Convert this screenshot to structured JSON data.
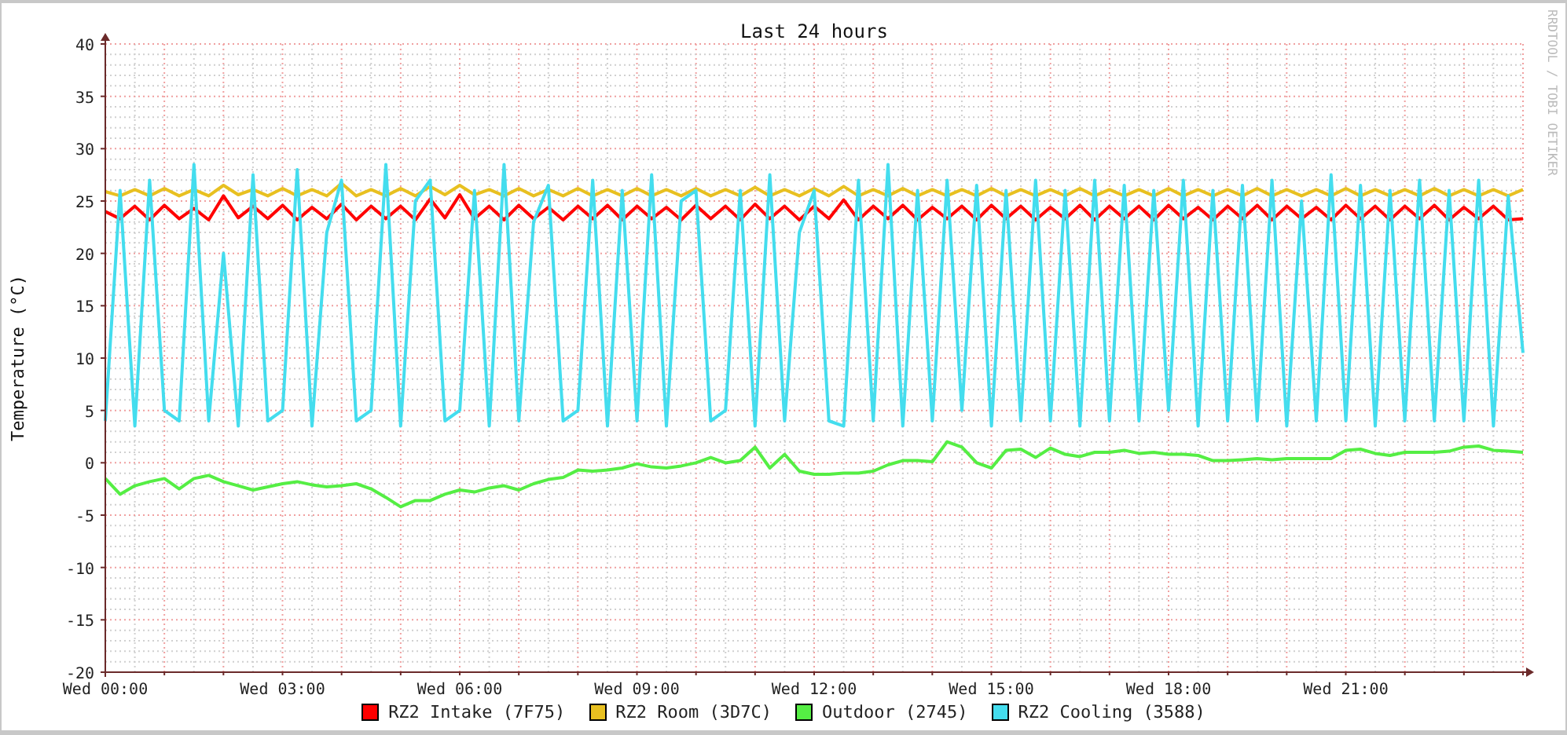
{
  "graph": {
    "credit": "RRDTOOL / TOBI OETIKER",
    "chart_data": {
      "type": "line",
      "grid": true,
      "title": "Last 24 hours",
      "ylabel": "Temperature (°C)",
      "ylim": [
        -20,
        40
      ],
      "yticks": [
        -20,
        -15,
        -10,
        -5,
        0,
        5,
        10,
        15,
        20,
        25,
        30,
        35,
        40
      ],
      "categories": [
        "Wed 00:00",
        null,
        null,
        null,
        null,
        null,
        null,
        null,
        null,
        null,
        null,
        null,
        "Wed 03:00",
        null,
        null,
        null,
        null,
        null,
        null,
        null,
        null,
        null,
        null,
        null,
        "Wed 06:00",
        null,
        null,
        null,
        null,
        null,
        null,
        null,
        null,
        null,
        null,
        null,
        "Wed 09:00",
        null,
        null,
        null,
        null,
        null,
        null,
        null,
        null,
        null,
        null,
        null,
        "Wed 12:00",
        null,
        null,
        null,
        null,
        null,
        null,
        null,
        null,
        null,
        null,
        null,
        "Wed 15:00",
        null,
        null,
        null,
        null,
        null,
        null,
        null,
        null,
        null,
        null,
        null,
        "Wed 18:00",
        null,
        null,
        null,
        null,
        null,
        null,
        null,
        null,
        null,
        null,
        null,
        "Wed 21:00",
        null,
        null,
        null,
        null,
        null,
        null,
        null,
        null,
        null,
        null,
        null,
        null
      ],
      "series": [
        {
          "name": "RZ2 Intake (7F75)",
          "color": "#ff0000",
          "values": [
            24,
            23.3,
            24.5,
            23.2,
            24.6,
            23.3,
            24.3,
            23.2,
            25.5,
            23.4,
            24.5,
            23.3,
            24.6,
            23.2,
            24.4,
            23.3,
            24.7,
            23.2,
            24.5,
            23.3,
            24.5,
            23.2,
            25.2,
            23.4,
            25.6,
            23.3,
            24.5,
            23.2,
            24.6,
            23.3,
            24.4,
            23.2,
            24.5,
            23.3,
            24.6,
            23.2,
            24.5,
            23.3,
            24.4,
            23.2,
            24.6,
            23.3,
            24.5,
            23.2,
            24.7,
            23.3,
            24.5,
            23.2,
            24.5,
            23.3,
            25.1,
            23.2,
            24.5,
            23.3,
            24.6,
            23.2,
            24.4,
            23.3,
            24.5,
            23.2,
            24.6,
            23.3,
            24.5,
            23.2,
            24.4,
            23.3,
            24.6,
            23.2,
            24.5,
            23.3,
            24.5,
            23.2,
            24.6,
            23.3,
            24.4,
            23.2,
            24.5,
            23.3,
            24.6,
            23.2,
            24.5,
            23.3,
            24.4,
            23.2,
            24.6,
            23.3,
            24.5,
            23.2,
            24.5,
            23.3,
            24.6,
            23.2,
            24.4,
            23.3,
            24.5,
            23.2,
            23.3
          ]
        },
        {
          "name": "RZ2 Room (3D7C)",
          "color": "#e8c020",
          "values": [
            25.9,
            25.5,
            26.1,
            25.5,
            26.2,
            25.5,
            26.1,
            25.5,
            26.5,
            25.6,
            26.1,
            25.5,
            26.2,
            25.5,
            26.1,
            25.5,
            26.7,
            25.5,
            26.1,
            25.5,
            26.2,
            25.5,
            26.4,
            25.6,
            26.5,
            25.6,
            26.1,
            25.5,
            26.2,
            25.5,
            26.1,
            25.5,
            26.2,
            25.5,
            26.1,
            25.5,
            26.2,
            25.5,
            26.1,
            25.5,
            26.2,
            25.5,
            26.1,
            25.5,
            26.3,
            25.5,
            26.1,
            25.5,
            26.2,
            25.5,
            26.4,
            25.5,
            26.1,
            25.5,
            26.2,
            25.5,
            26.1,
            25.5,
            26.1,
            25.5,
            26.2,
            25.5,
            26.1,
            25.5,
            26.1,
            25.5,
            26.2,
            25.5,
            26.1,
            25.5,
            26.1,
            25.5,
            26.2,
            25.5,
            26.1,
            25.5,
            26.1,
            25.5,
            26.2,
            25.5,
            26.1,
            25.5,
            26.1,
            25.5,
            26.2,
            25.5,
            26.1,
            25.5,
            26.1,
            25.5,
            26.2,
            25.5,
            26.1,
            25.5,
            26.1,
            25.5,
            26.1
          ]
        },
        {
          "name": "Outdoor (2745)",
          "color": "#55ee44",
          "values": [
            -1.5,
            -3,
            -2.2,
            -1.8,
            -1.5,
            -2.5,
            -1.5,
            -1.2,
            -1.8,
            -2.2,
            -2.6,
            -2.3,
            -2,
            -1.8,
            -2.1,
            -2.3,
            -2.2,
            -2,
            -2.5,
            -3.3,
            -4.2,
            -3.6,
            -3.6,
            -3,
            -2.6,
            -2.8,
            -2.4,
            -2.2,
            -2.6,
            -2,
            -1.6,
            -1.4,
            -0.7,
            -0.8,
            -0.7,
            -0.5,
            -0.1,
            -0.4,
            -0.5,
            -0.3,
            0,
            0.5,
            0,
            0.2,
            1.5,
            -0.5,
            0.8,
            -0.8,
            -1.1,
            -1.1,
            -1,
            -1,
            -0.8,
            -0.2,
            0.2,
            0.2,
            0.1,
            2,
            1.5,
            0,
            -0.5,
            1.2,
            1.3,
            0.5,
            1.4,
            0.8,
            0.6,
            1,
            1,
            1.2,
            0.9,
            1,
            0.8,
            0.8,
            0.7,
            0.2,
            0.2,
            0.3,
            0.4,
            0.3,
            0.4,
            0.4,
            0.4,
            0.4,
            1.2,
            1.3,
            0.9,
            0.7,
            1,
            1,
            1,
            1.1,
            1.5,
            1.6,
            1.2,
            1.1,
            1
          ]
        },
        {
          "name": "RZ2 Cooling (3588)",
          "color": "#44ddee",
          "values": [
            4,
            26,
            3.5,
            27,
            5,
            4,
            28.5,
            4,
            20,
            3.5,
            27.5,
            4,
            5,
            28,
            3.5,
            22,
            27,
            4,
            5,
            28.5,
            3.5,
            25,
            27,
            4,
            5,
            26,
            3.5,
            28.5,
            4,
            23,
            26.5,
            4,
            5,
            27,
            3.5,
            26,
            4,
            27.5,
            3.5,
            25,
            26,
            4,
            5,
            26,
            3.5,
            27.5,
            4,
            22,
            26,
            4,
            3.5,
            27,
            4,
            28.5,
            3.5,
            26,
            4,
            27,
            5,
            26.5,
            3.5,
            26,
            4,
            27,
            4,
            26,
            3.5,
            27,
            4,
            26.5,
            4,
            26,
            5,
            27,
            3.5,
            26,
            4,
            26.5,
            4,
            27,
            3.5,
            25,
            4,
            27.5,
            4,
            26.5,
            3.5,
            26,
            4,
            27,
            4,
            26,
            4,
            27,
            3.5,
            25.5,
            10.5
          ]
        }
      ]
    }
  }
}
